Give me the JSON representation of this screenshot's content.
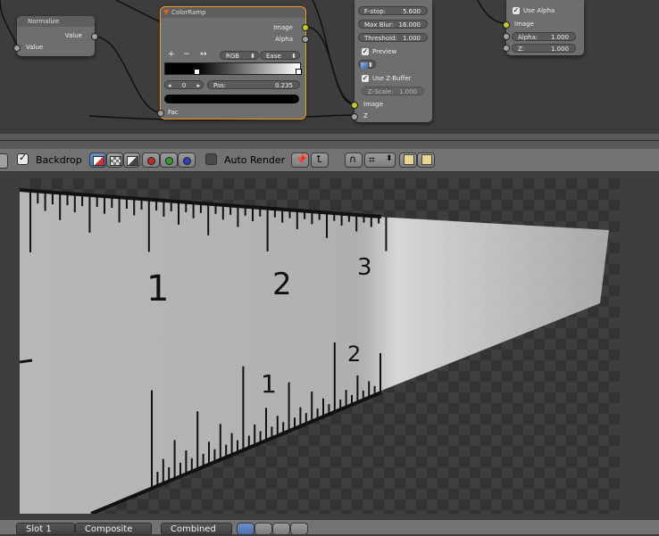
{
  "node_editor": {
    "normalize_node": {
      "title": "Normalize",
      "output_label": "Value",
      "input_label": "Value"
    },
    "colorramp_node": {
      "title": "ColorRamp",
      "outputs": [
        "Image",
        "Alpha"
      ],
      "buttons": {
        "add": "+",
        "remove": "−",
        "flip": "↔"
      },
      "color_mode": "RGB",
      "interpolation": "Ease",
      "stop_index": "0",
      "pos_label": "Pos:",
      "pos_value": "0.235",
      "input_label": "Fac"
    },
    "defocus_node": {
      "fstop_label": "F-stop:",
      "fstop_value": "5.600",
      "maxblur_label": "Max Blur:",
      "maxblur_value": "16.000",
      "threshold_label": "Threshold:",
      "threshold_value": "1.000",
      "preview_label": "Preview",
      "use_zbuffer_label": "Use Z-Buffer",
      "zscale_label": "Z-Scale:",
      "zscale_value": "1.000",
      "input_image": "Image",
      "input_z": "Z"
    },
    "composite_node": {
      "use_alpha_label": "Use Alpha",
      "input_image": "Image",
      "alpha_label": "Alpha:",
      "alpha_value": "1.000",
      "z_label": "Z:",
      "z_value": "1.000"
    }
  },
  "header": {
    "backdrop_label": "Backdrop",
    "auto_render_label": "Auto Render",
    "channel_icons": [
      "color-alpha-icon",
      "alpha-icon",
      "color-icon"
    ],
    "channel_dots": [
      "#c22b2b",
      "#2f9e2f",
      "#2b3fbf"
    ]
  },
  "backdrop": {
    "upper_labels": [
      "1",
      "2",
      "3"
    ],
    "lower_labels": [
      "1",
      "2"
    ]
  },
  "bottom_bar": {
    "slot": "Slot 1",
    "image": "Composite",
    "pass": "Combined"
  },
  "colors": {
    "socket_gray": "#a1a1a1",
    "socket_yellow": "#c7c729",
    "selected_node_border": "#f29b1f",
    "active_button": "#5a7fbf"
  }
}
